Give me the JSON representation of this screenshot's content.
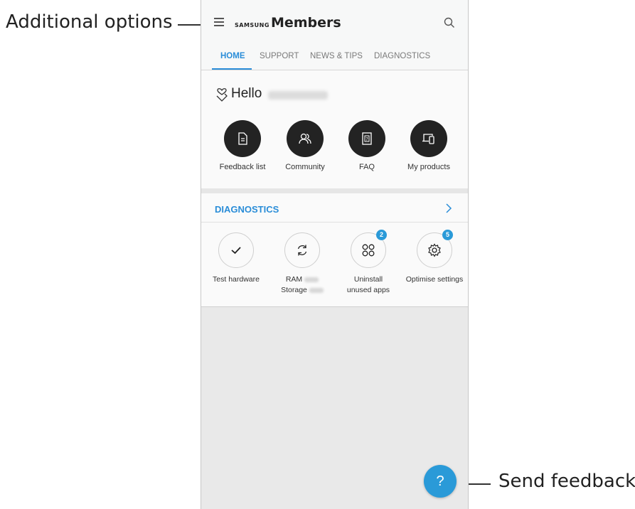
{
  "callouts": {
    "additional_options": "Additional options",
    "send_feedback": "Send feedback."
  },
  "app": {
    "brand_samsung": "SAMSUNG",
    "brand_members": "Members"
  },
  "tabs": [
    {
      "label": "HOME",
      "active": true
    },
    {
      "label": "SUPPORT",
      "active": false
    },
    {
      "label": "NEWS & TIPS",
      "active": false
    },
    {
      "label": "DIAGNOSTICS",
      "active": false
    }
  ],
  "greeting": {
    "text": "Hello"
  },
  "quick_actions": [
    {
      "label": "Feedback list",
      "icon": "document-icon"
    },
    {
      "label": "Community",
      "icon": "people-icon"
    },
    {
      "label": "FAQ",
      "icon": "faq-book-icon"
    },
    {
      "label": "My products",
      "icon": "devices-icon"
    }
  ],
  "diagnostics": {
    "title": "DIAGNOSTICS",
    "items": [
      {
        "label": "Test hardware",
        "icon": "check-icon"
      },
      {
        "label_line1": "RAM",
        "label_line2": "Storage",
        "icon": "refresh-icon"
      },
      {
        "label": "Uninstall unused apps",
        "icon": "apps-grid-icon",
        "badge": "2"
      },
      {
        "label": "Optimise settings",
        "icon": "gear-icon",
        "badge": "5"
      }
    ]
  },
  "fab": {
    "label": "?"
  },
  "colors": {
    "accent": "#2a8dd8",
    "badge": "#2a9ad8",
    "dark_icon_bg": "#232323",
    "background": "#e9e9e9"
  }
}
